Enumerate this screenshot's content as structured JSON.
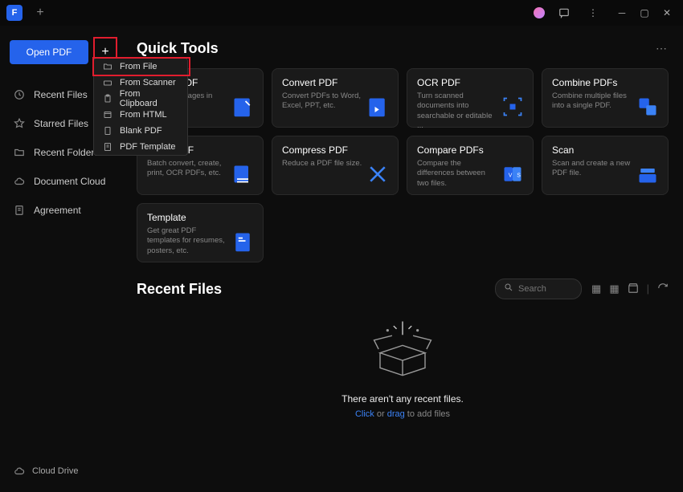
{
  "titlebar": {
    "app_logo_glyph": "F"
  },
  "sidebar": {
    "open_label": "Open PDF",
    "nav": [
      {
        "icon": "clock",
        "label": "Recent Files"
      },
      {
        "icon": "star",
        "label": "Starred Files"
      },
      {
        "icon": "folder",
        "label": "Recent Folders"
      },
      {
        "icon": "cloud",
        "label": "Document Cloud"
      },
      {
        "icon": "doc",
        "label": "Agreement"
      }
    ],
    "cloud_drive": "Cloud Drive"
  },
  "dropdown": {
    "items": [
      {
        "label": "From File"
      },
      {
        "label": "From Scanner"
      },
      {
        "label": "From Clipboard"
      },
      {
        "label": "From HTML"
      },
      {
        "label": "Blank PDF"
      },
      {
        "label": "PDF Template"
      }
    ]
  },
  "quick_tools": {
    "title": "Quick Tools",
    "cards": [
      {
        "title": "Create PDF",
        "desc": "Combine images in PDF."
      },
      {
        "title": "Convert PDF",
        "desc": "Convert PDFs to Word, Excel, PPT, etc."
      },
      {
        "title": "OCR PDF",
        "desc": "Turn scanned documents into searchable or editable ..."
      },
      {
        "title": "Combine PDFs",
        "desc": "Combine multiple files into a single PDF."
      },
      {
        "title": "Batch PDF",
        "desc": "Batch convert, create, print, OCR PDFs, etc."
      },
      {
        "title": "Compress PDF",
        "desc": "Reduce a PDF file size."
      },
      {
        "title": "Compare PDFs",
        "desc": "Compare the differences between two files."
      },
      {
        "title": "Scan",
        "desc": "Scan and create a new PDF file."
      }
    ],
    "template": {
      "title": "Template",
      "desc": "Get great PDF templates for resumes, posters, etc."
    }
  },
  "recent": {
    "title": "Recent Files",
    "search_placeholder": "Search",
    "empty_text": "There aren't any recent files.",
    "hint_click": "Click",
    "hint_or": " or ",
    "hint_drag": "drag",
    "hint_rest": " to add files"
  }
}
